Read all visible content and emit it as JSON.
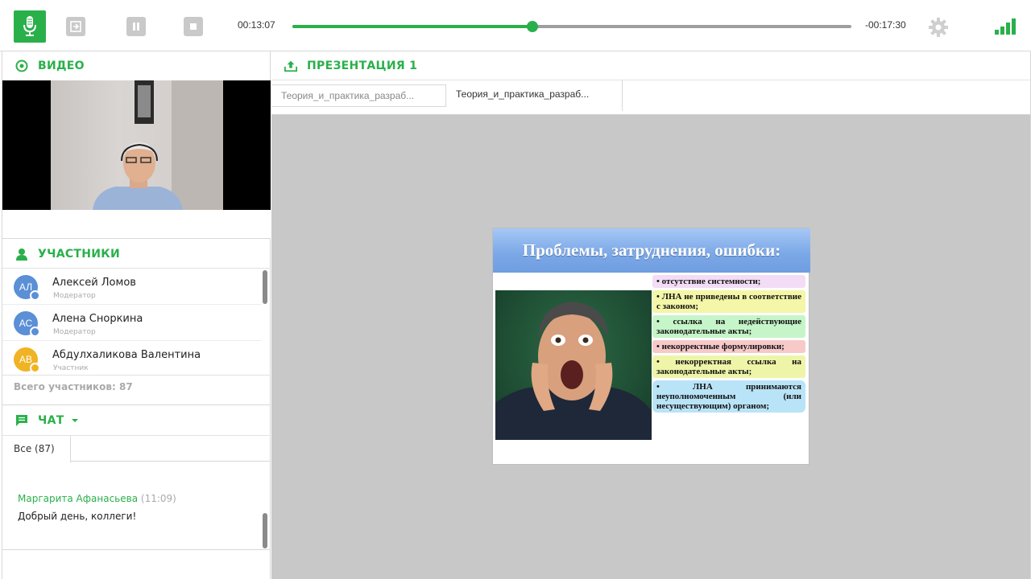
{
  "toolbar": {
    "elapsed": "00:13:07",
    "remaining": "-00:17:30",
    "progress_fraction": 0.43
  },
  "video": {
    "title": "ВИДЕО"
  },
  "participants": {
    "title": "УЧАСТНИКИ",
    "items": [
      {
        "initials": "АЛ",
        "name": "Алексей Ломов",
        "role": "Модератор",
        "color": "#5b8fd6"
      },
      {
        "initials": "АС",
        "name": "Алена Сноркина",
        "role": "Модератор",
        "color": "#5b8fd6"
      },
      {
        "initials": "АВ",
        "name": "Абдулхаликова Валентина",
        "role": "Участник",
        "color": "#f0b323"
      }
    ],
    "total": "Всего участников: 87"
  },
  "chat": {
    "title": "ЧАТ",
    "tab": "Все (87)",
    "messages": [
      {
        "author": "Маргарита Афанасьева",
        "time": "(11:09)",
        "text": "Добрый день, коллеги!"
      }
    ]
  },
  "presentation": {
    "title": "ПРЕЗЕНТАЦИЯ 1",
    "tabs": [
      "Теория_и_практика_разраб...",
      "Теория_и_практика_разраб..."
    ],
    "slide": {
      "title": "Проблемы, затруднения, ошибки:",
      "bullets": [
        {
          "text": "• отсутствие системности;",
          "color": "#f3dcf5"
        },
        {
          "text": "• ЛНА не приведены в соответствие с законом;",
          "color": "#f4f6a8"
        },
        {
          "text": "• ссылка на недействующие законодательные акты;",
          "color": "#c5f5c8"
        },
        {
          "text": "• некорректные формулировки;",
          "color": "#f7c9c9"
        },
        {
          "text": "• некорректная ссылка на законодательные акты;",
          "color": "#eef5a8"
        },
        {
          "text": "• ЛНА принимаются неуполномоченным (или несуществующим) органом;",
          "color": "#b9e4f7"
        }
      ]
    }
  },
  "colors": {
    "accent": "#2ab04a"
  }
}
